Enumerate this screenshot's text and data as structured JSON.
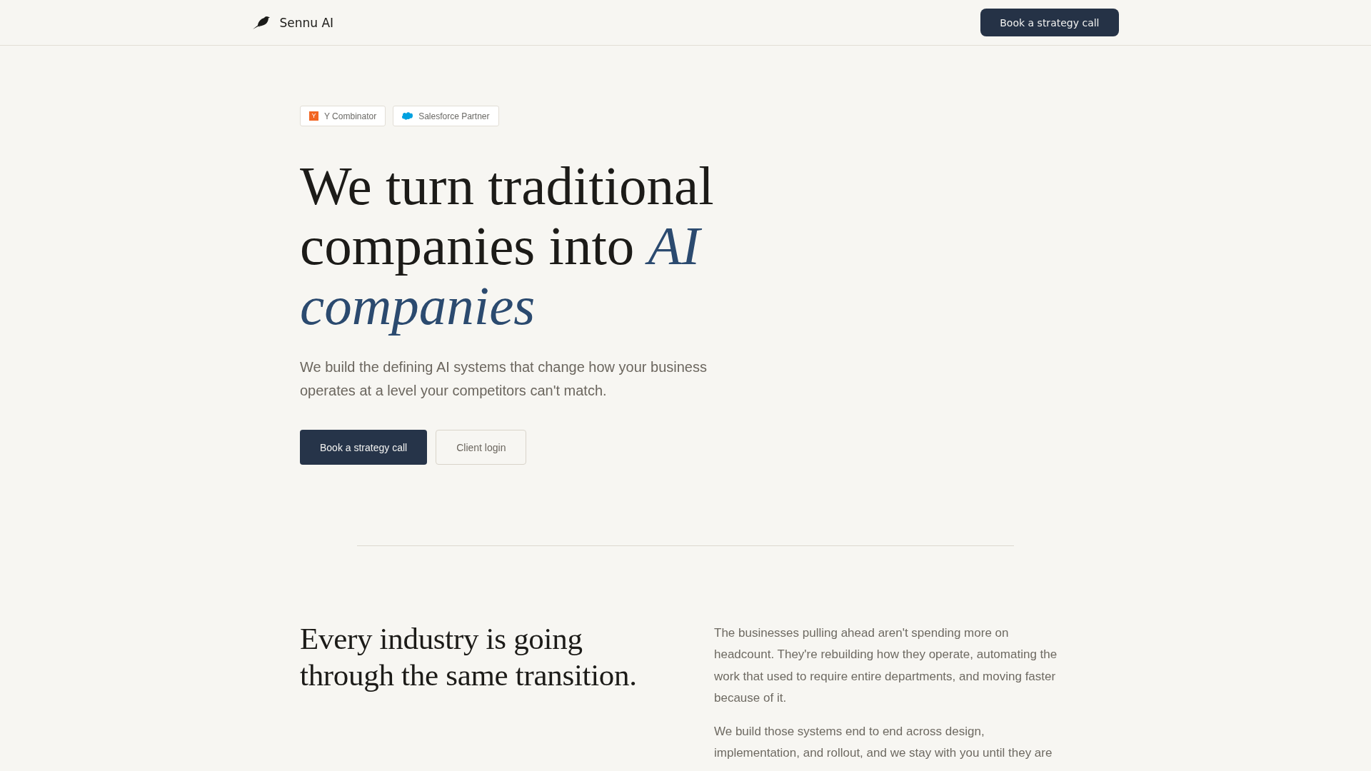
{
  "header": {
    "brand": "Sennu AI",
    "cta": "Book a strategy call"
  },
  "hero": {
    "badges": [
      {
        "kind": "letter",
        "logo_text": "Y",
        "label": "Y Combinator"
      },
      {
        "kind": "cloud",
        "label": "Salesforce Partner"
      }
    ],
    "headline": "We turn traditional companies into *AI companies*",
    "subtitle": "We build the defining AI systems that change how your business operates at a level your competitors can't match.",
    "buttons": [
      {
        "kind": "primary",
        "label": "Book a strategy call"
      },
      {
        "kind": "secondary",
        "label": "Client login"
      }
    ]
  },
  "section": {
    "heading": "Every industry is going through the same transition.",
    "paragraphs": [
      "The businesses pulling ahead aren't spending more on headcount. They're rebuilding how they operate, automating the work that used to require entire departments, and moving faster because of it.",
      "We build those systems end to end across design, implementation, and rollout, and we stay with you until they are"
    ]
  }
}
